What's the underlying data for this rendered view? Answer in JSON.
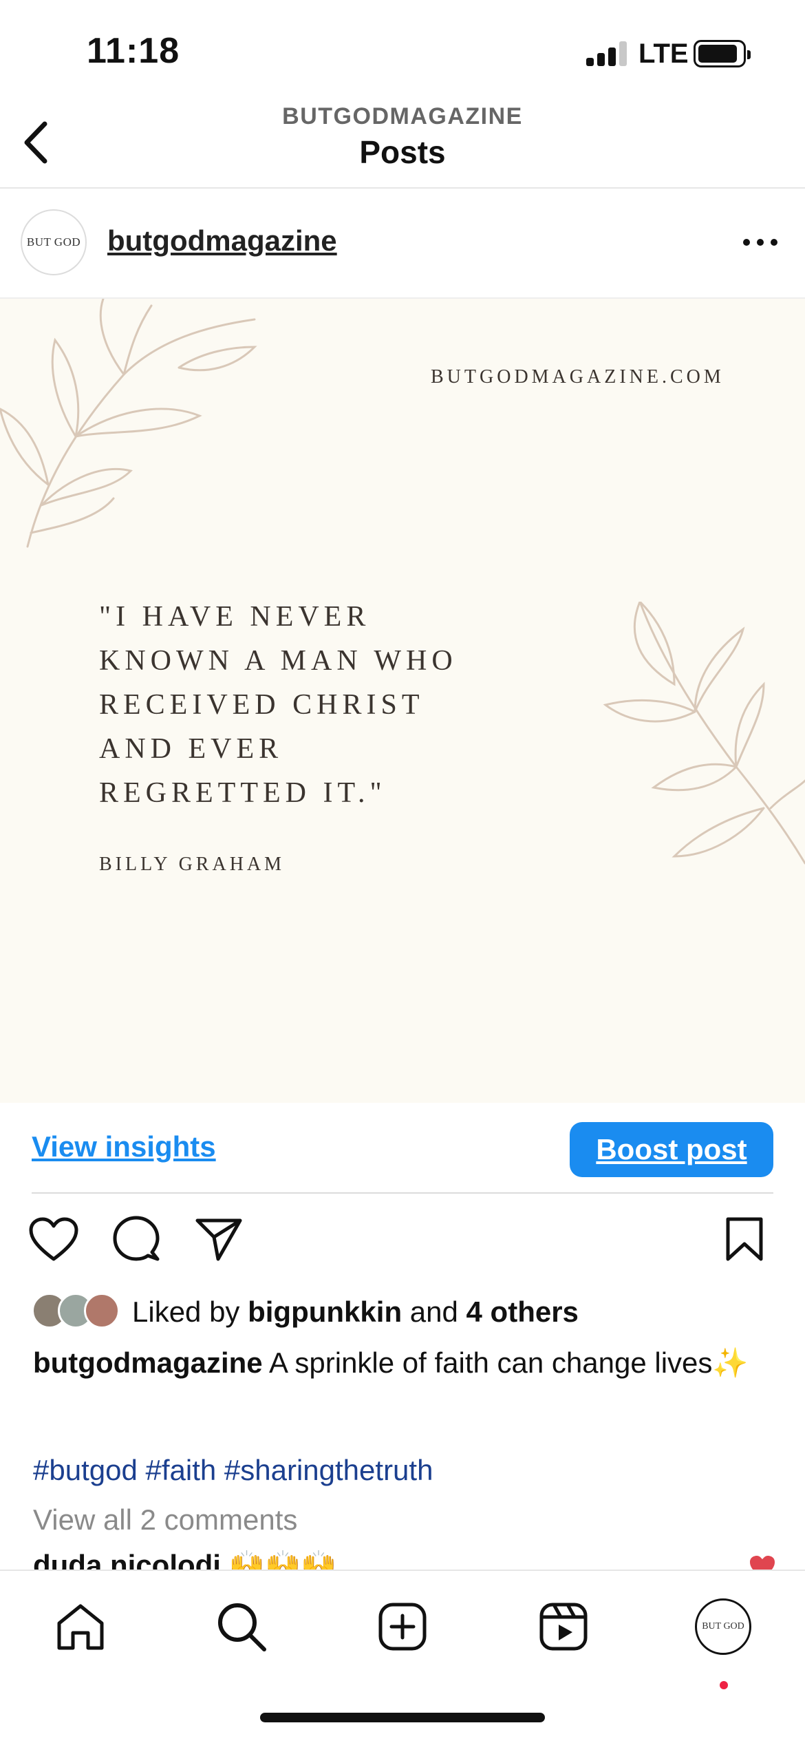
{
  "status_bar": {
    "time": "11:18",
    "network": "LTE",
    "battery_level": 0.8
  },
  "header": {
    "account": "BUTGODMAGAZINE",
    "title": "Posts"
  },
  "post": {
    "author": "butgodmagazine",
    "avatar_text": "BUT GOD",
    "image": {
      "website": "BUTGODMAGAZINE.COM",
      "quote": "\"I HAVE NEVER\nKNOWN A MAN WHO\nRECEIVED CHRIST\nAND EVER\nREGRETTED IT.\"",
      "quote_author": "BILLY GRAHAM"
    },
    "view_insights_label": "View insights",
    "boost_label": "Boost post",
    "likes": {
      "prefix": "Liked by ",
      "user": "bigpunkkin",
      "middle": " and ",
      "others": "4 others"
    },
    "caption": {
      "author": "butgodmagazine",
      "text": " A sprinkle of faith can change lives✨"
    },
    "hashtags": "#butgod #faith #sharingthetruth",
    "view_comments": "View all 2 comments",
    "comment_preview": "duda.nicolodi 🙌🙌🙌"
  },
  "tabbar": {
    "items": [
      "home-icon",
      "search-icon",
      "create-icon",
      "reels-icon",
      "profile-avatar"
    ],
    "profile_avatar_text": "BUT GOD"
  },
  "colors": {
    "accent": "#1a8cf0",
    "hashtag": "#1b3f8f",
    "image_bg": "#fcfaf3",
    "leaf": "#d9c8b8"
  }
}
